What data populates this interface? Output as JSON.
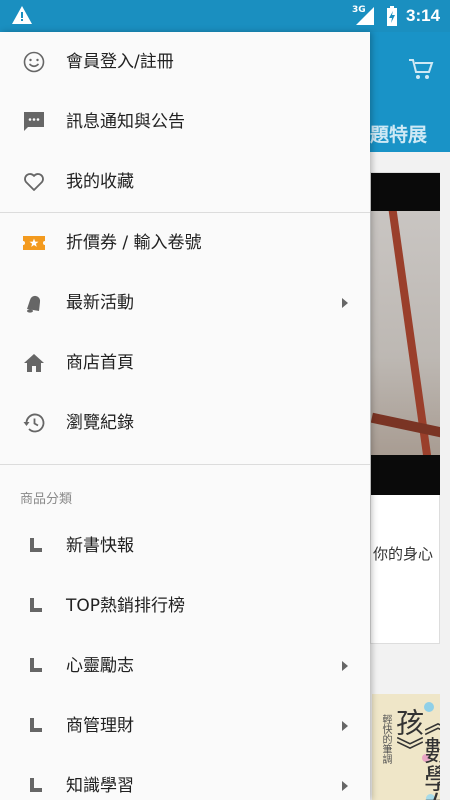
{
  "status_bar": {
    "network": "3G",
    "time": "3:14"
  },
  "background": {
    "partial_title": "題特展",
    "partial_caption": "你的身心",
    "book_title": "《數學女孩》",
    "book_subtitle": "輕快的筆調"
  },
  "drawer": {
    "items": [
      {
        "label": "會員登入/註冊",
        "icon": "smiley-icon"
      },
      {
        "label": "訊息通知與公告",
        "icon": "message-icon"
      },
      {
        "label": "我的收藏",
        "icon": "heart-icon"
      },
      {
        "label": "折價券 / 輸入卷號",
        "icon": "coupon-icon"
      },
      {
        "label": "最新活動",
        "icon": "bell-icon",
        "has_submenu": true
      },
      {
        "label": "商店首頁",
        "icon": "home-icon"
      },
      {
        "label": "瀏覽紀錄",
        "icon": "history-icon"
      }
    ],
    "category_header": "商品分類",
    "categories": [
      {
        "label": "新書快報",
        "has_submenu": false
      },
      {
        "label": "TOP熱銷排行榜",
        "has_submenu": false
      },
      {
        "label": "心靈勵志",
        "has_submenu": true
      },
      {
        "label": "商管理財",
        "has_submenu": true
      },
      {
        "label": "知識學習",
        "has_submenu": true
      }
    ]
  },
  "colors": {
    "status_bar": "#1a8fc0",
    "toolbar": "#1993c7",
    "coupon_accent": "#f39a1e",
    "icon_gray": "#666666"
  }
}
